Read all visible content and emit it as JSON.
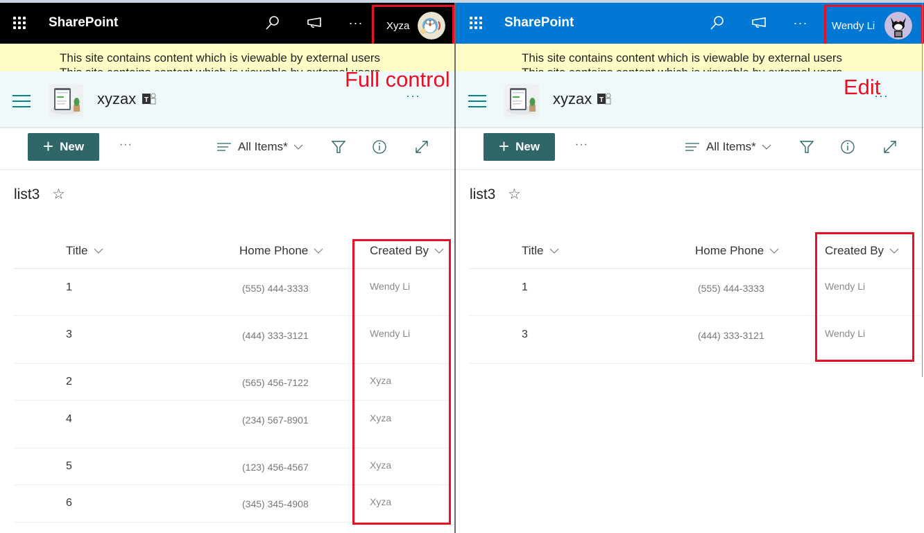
{
  "panes": [
    {
      "id": "left",
      "suitebar": {
        "brand": "SharePoint",
        "user_name": "Xyza",
        "avatar": "doraemon-avatar",
        "bg_color": "#000000"
      },
      "banner": {
        "line1": "This site contains content which is viewable by external users",
        "line2": "This site contains content which is viewable by external users"
      },
      "site": {
        "title": "xyzax",
        "more_label": "···"
      },
      "annotation": "Full control",
      "command_bar": {
        "new_label": "New",
        "more_label": "···",
        "view_label": "All Items*"
      },
      "list": {
        "title": "list3",
        "columns": [
          "Title",
          "Home Phone",
          "Created By"
        ],
        "rows": [
          {
            "title": "1",
            "phone": "(555) 444-3333",
            "created_by": "Wendy Li"
          },
          {
            "title": "3",
            "phone": "(444) 333-3121",
            "created_by": "Wendy Li"
          },
          {
            "title": "2",
            "phone": "(565) 456-7122",
            "created_by": "Xyza"
          },
          {
            "title": "4",
            "phone": "(234) 567-8901",
            "created_by": "Xyza"
          },
          {
            "title": "5",
            "phone": "(123) 456-4567",
            "created_by": "Xyza"
          },
          {
            "title": "6",
            "phone": "(345) 345-4908",
            "created_by": "Xyza"
          }
        ]
      }
    },
    {
      "id": "right",
      "suitebar": {
        "brand": "SharePoint",
        "user_name": "Wendy Li",
        "avatar": "kuromi-avatar",
        "bg_color": "#0078d4"
      },
      "banner": {
        "line1": "This site contains content which is viewable by external users",
        "line2": "This site contains content which is viewable by external users"
      },
      "site": {
        "title": "xyzax",
        "more_label": "···"
      },
      "annotation": "Edit",
      "command_bar": {
        "new_label": "New",
        "more_label": "···",
        "view_label": "All Items*"
      },
      "list": {
        "title": "list3",
        "columns": [
          "Title",
          "Home Phone",
          "Created By"
        ],
        "rows": [
          {
            "title": "1",
            "phone": "(555) 444-3333",
            "created_by": "Wendy Li"
          },
          {
            "title": "3",
            "phone": "(444) 333-3121",
            "created_by": "Wendy Li"
          }
        ]
      }
    }
  ],
  "colors": {
    "highlight_box": "#e81123",
    "new_button": "#2f6768",
    "theme_teal": "#038387",
    "banner_bg": "#fffdc6",
    "site_header_bg": "#eff8fa"
  }
}
